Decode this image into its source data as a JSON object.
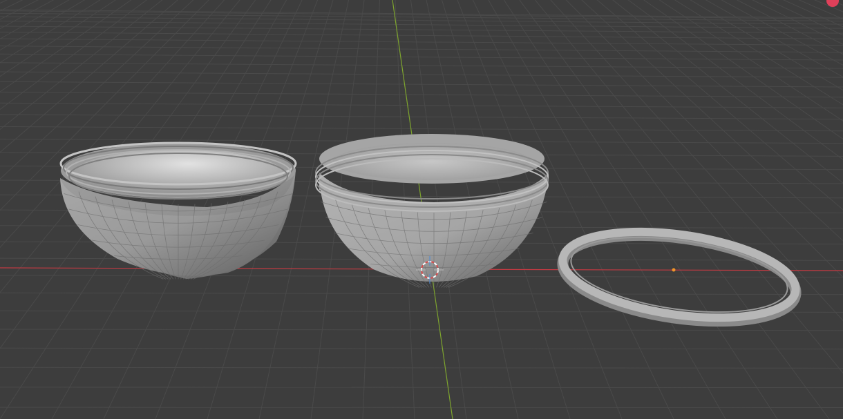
{
  "viewport": {
    "background_color": "#3d3d3d",
    "grid_color": "#4a4a4a",
    "x_axis_color": "#c43a42",
    "y_axis_color": "#7ea52e",
    "origin_dot_color": "#f0962a",
    "gizmo_color": "#ffffff"
  },
  "objects": [
    {
      "name": "hemisphere-shell-left",
      "kind": "threaded half-sphere shell"
    },
    {
      "name": "hemisphere-shell-center",
      "kind": "threaded half-sphere shell"
    },
    {
      "name": "torus-ring-right",
      "kind": "flat ring"
    }
  ],
  "icons": {
    "cursor": "3d-cursor-icon",
    "close": "close-icon"
  },
  "close_button": {
    "color": "#e0405a"
  }
}
